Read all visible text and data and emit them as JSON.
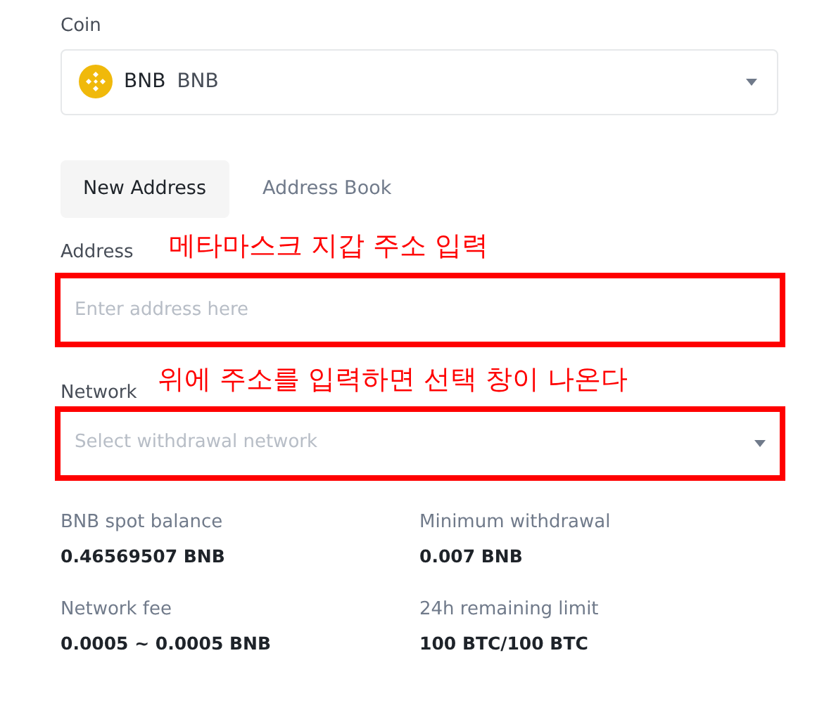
{
  "coin": {
    "label": "Coin",
    "symbol": "BNB",
    "name": "BNB"
  },
  "tabs": [
    {
      "label": "New Address",
      "selected": true
    },
    {
      "label": "Address Book",
      "selected": false
    }
  ],
  "fields": [
    {
      "kind": "input",
      "label": "Address",
      "placeholder": "Enter address here",
      "annotation": "메타마스크 지갑 주소 입력",
      "highlighted": true
    },
    {
      "kind": "select",
      "label": "Network",
      "placeholder": "Select withdrawal network",
      "annotation": "위에 주소를 입력하면 선택 창이 나온다",
      "highlighted": true
    }
  ],
  "stats": [
    {
      "label": "BNB spot balance",
      "value": "0.46569507 BNB"
    },
    {
      "label": "Minimum withdrawal",
      "value": "0.007 BNB"
    },
    {
      "label": "Network fee",
      "value": "0.0005 ~ 0.0005 BNB"
    },
    {
      "label": "24h remaining limit",
      "value": "100 BTC/100 BTC"
    }
  ]
}
